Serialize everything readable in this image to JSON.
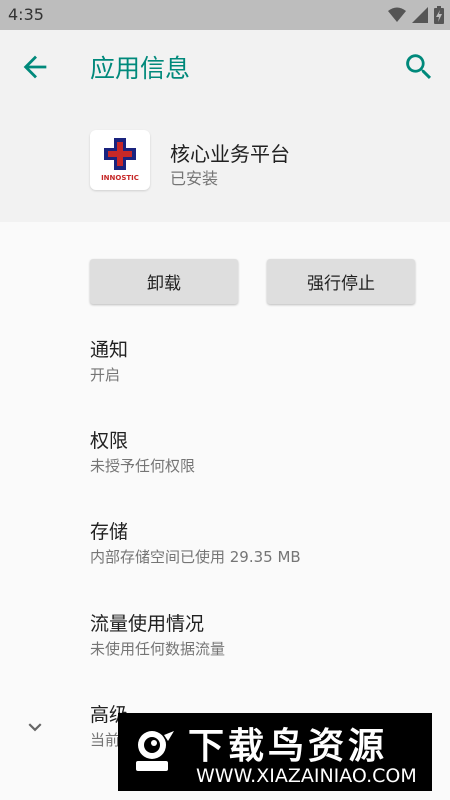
{
  "status_bar": {
    "time": "4:35",
    "icons": [
      "wifi-icon",
      "signal-icon",
      "battery-icon"
    ]
  },
  "app_bar": {
    "title": "应用信息",
    "back_icon": "arrow-left-icon",
    "search_icon": "search-icon",
    "accent_color": "#00897b"
  },
  "app": {
    "name": "核心业务平台",
    "status": "已安装",
    "icon_text": "INNOSTIC"
  },
  "buttons": {
    "uninstall": "卸载",
    "force_stop": "强行停止"
  },
  "settings": [
    {
      "title": "通知",
      "subtitle": "开启"
    },
    {
      "title": "权限",
      "subtitle": "未授予任何权限"
    },
    {
      "title": "存储",
      "subtitle": "内部存储空间已使用 29.35 MB"
    },
    {
      "title": "流量使用情况",
      "subtitle": "未使用任何数据流量"
    },
    {
      "title": "高级",
      "subtitle": "当前"
    }
  ],
  "watermark": {
    "title": "下载鸟资源",
    "url": "WWW.XIAZAINIAO.COM"
  }
}
